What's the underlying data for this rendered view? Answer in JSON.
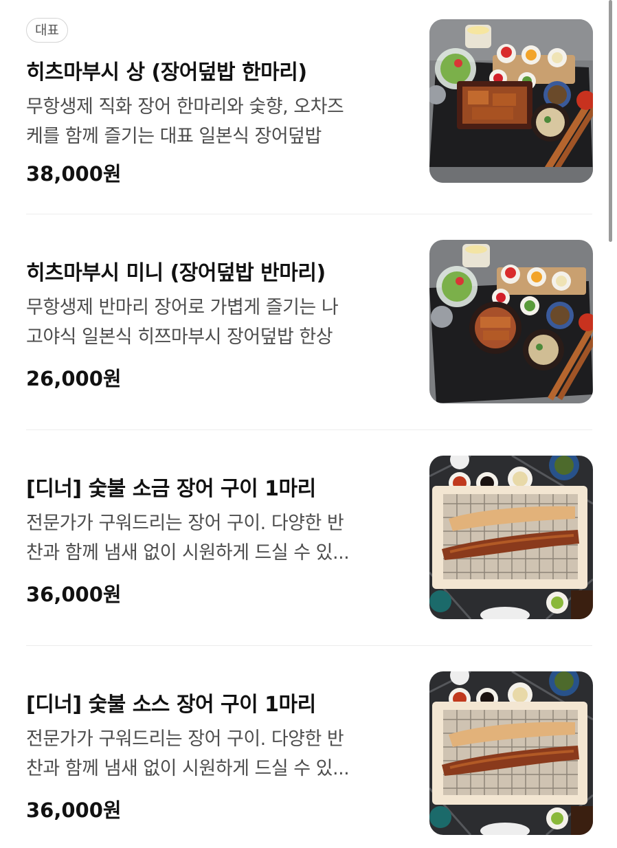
{
  "menu": {
    "items": [
      {
        "badge": "대표",
        "title": "히츠마부시 상 (장어덮밥 한마리)",
        "desc_line1": "무항생제 직화 장어 한마리와 숯향, 오차즈",
        "desc_line2": "케를 함께 즐기는 대표 일본식 장어덮밥",
        "price": "38,000원",
        "image": "eel-rice-set-full-photo"
      },
      {
        "title": "히츠마부시 미니 (장어덮밥 반마리)",
        "desc_line1": "무항생제 반마리 장어로 가볍게 즐기는 나",
        "desc_line2": "고야식 일본식 히쯔마부시 장어덮밥 한상",
        "price": "26,000원",
        "image": "eel-rice-set-half-photo"
      },
      {
        "title": "[디너] 숯불 소금 장어 구이 1마리",
        "desc_line1": "전문가가 구워드리는 장어 구이. 다양한 반",
        "desc_line2": "찬과 함께 냄새 없이 시원하게 드실 수 있...",
        "price": "36,000원",
        "image": "grilled-eel-salt-photo"
      },
      {
        "title": "[디너] 숯불 소스 장어 구이 1마리",
        "desc_line1": "전문가가 구워드리는 장어 구이. 다양한 반",
        "desc_line2": "찬과 함께 냄새 없이 시원하게 드실 수 있...",
        "price": "36,000원",
        "image": "grilled-eel-sauce-photo"
      }
    ]
  },
  "colors": {
    "text_primary": "#111111",
    "text_secondary": "#4d4d4d",
    "divider": "#ececec",
    "badge_border": "#d4d4d4"
  }
}
